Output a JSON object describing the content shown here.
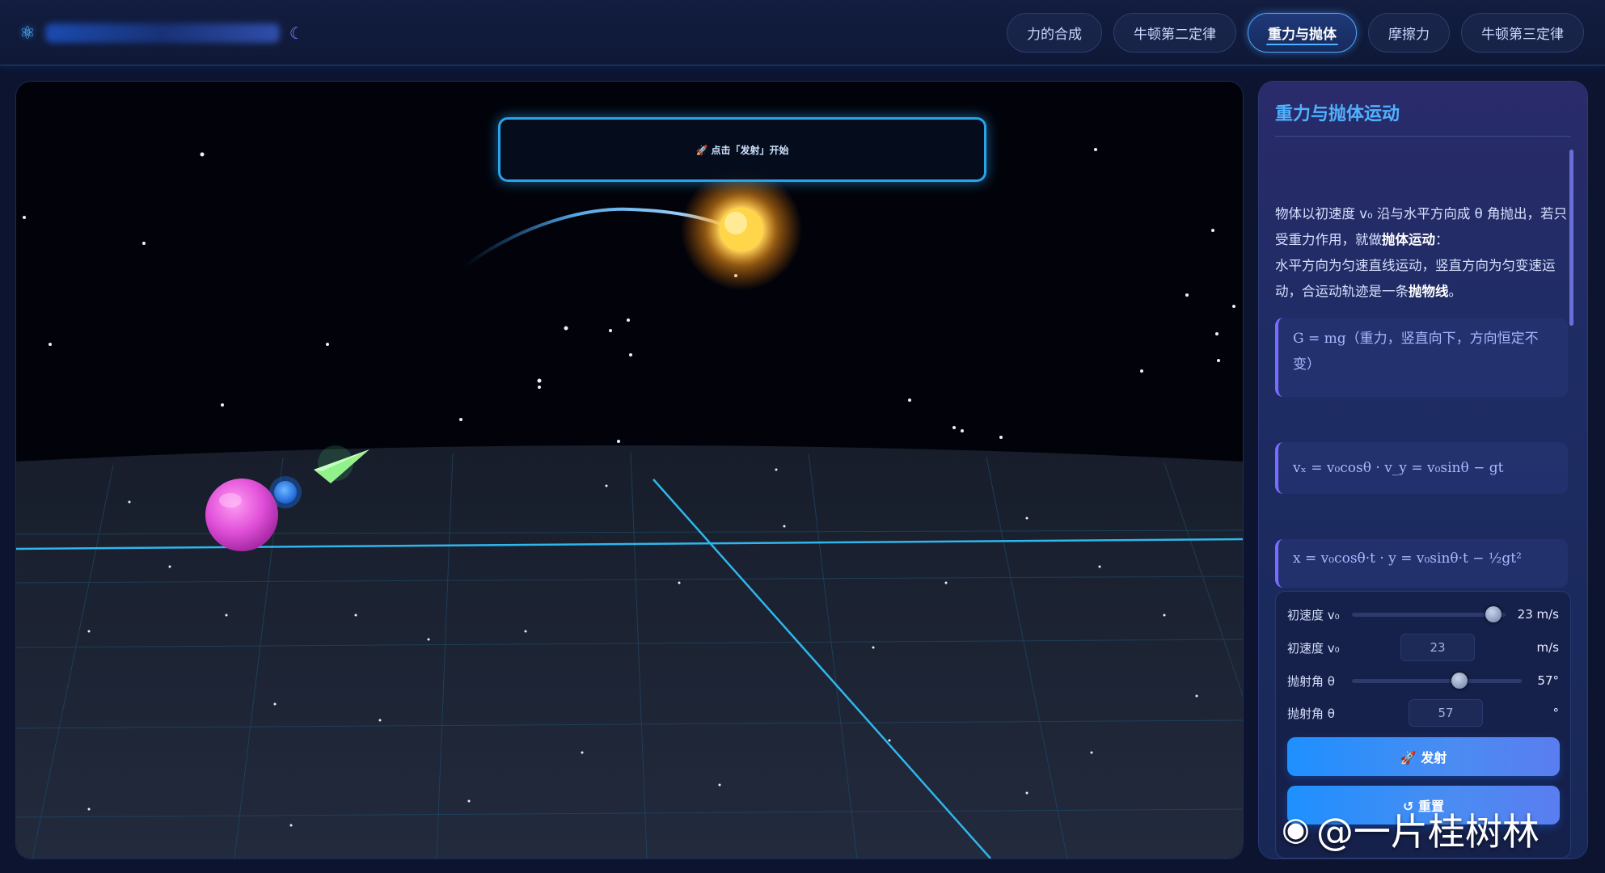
{
  "header": {
    "logo_icon": "atom-icon",
    "tabs": [
      {
        "label": "力的合成",
        "active": false
      },
      {
        "label": "牛顿第二定律",
        "active": false
      },
      {
        "label": "重力与抛体",
        "active": true
      },
      {
        "label": "摩擦力",
        "active": false
      },
      {
        "label": "牛顿第三定律",
        "active": false
      }
    ]
  },
  "scene": {
    "banner_text": "🚀 点击「发射」开始"
  },
  "panel": {
    "title": "重力与抛体运动",
    "desc_line1": "物体以初速度 v₀ 沿与水平方向成 θ 角抛出，若只受重力作用，就做",
    "desc_bold1": "抛体运动",
    "desc_line2": "：",
    "desc_line3": "水平方向为匀速直线运动，竖直方向为匀变速运动，合运动轨迹是一条",
    "desc_bold2": "抛物线",
    "desc_end": "。",
    "formula1": "G = mg（重力，竖直向下，方向恒定不变）",
    "formula2": "vₓ = v₀cosθ · v_y = v₀sinθ − gt",
    "formula3": "x = v₀cosθ·t · y = v₀sinθ·t − ½gt²"
  },
  "controls": {
    "speed_label": "初速度 v₀",
    "speed_value": 23,
    "speed_range_max": 25,
    "speed_display": "23 m/s",
    "speed_input_label": "初速度 v₀",
    "speed_input": "23",
    "speed_unit": "m/s",
    "angle_label": "抛射角 θ",
    "angle_value": 57,
    "angle_range_max": 90,
    "angle_display": "57°",
    "angle_input_label": "抛射角 θ",
    "angle_input": "57",
    "angle_unit": "°",
    "launch_label": "🚀 发射",
    "reset_label": "↺ 重置"
  },
  "watermark": {
    "text": "@一片桂树林",
    "icon": "weibo-icon"
  }
}
